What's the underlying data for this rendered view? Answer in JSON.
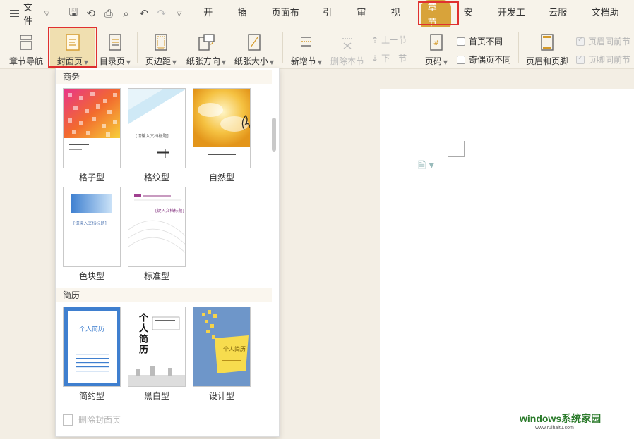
{
  "menubar": {
    "file_label": "文件",
    "tabs": [
      "开始",
      "插入",
      "页面布局",
      "引用",
      "审阅",
      "视图",
      "章节",
      "安全",
      "开发工具",
      "云服务",
      "文档助手"
    ],
    "active_tab": "章节"
  },
  "ribbon": {
    "nav": "章节导航",
    "cover": "封面页",
    "toc": "目录页",
    "margins": "页边距",
    "orientation": "纸张方向",
    "size": "纸张大小",
    "new_section": "新增节",
    "delete_section": "删除本节",
    "prev_section": "上一节",
    "next_section": "下一节",
    "page_number": "页码",
    "first_page_diff": "首页不同",
    "odd_even_diff": "奇偶页不同",
    "header_footer": "页眉和页脚",
    "header_same_prev": "页眉同前节",
    "footer_same_prev": "页脚同前节"
  },
  "panel": {
    "section_business": "商务",
    "section_resume": "简历",
    "business": [
      {
        "name": "格子型"
      },
      {
        "name": "格纹型",
        "title": "[请输入文档标题]"
      },
      {
        "name": "自然型"
      },
      {
        "name": "色块型",
        "title": "[请输入文档标题]"
      },
      {
        "name": "标准型",
        "title": "[键入文档标题]"
      }
    ],
    "resume": [
      {
        "name": "简约型",
        "title": "个人简历"
      },
      {
        "name": "黑白型",
        "title": "个人简历"
      },
      {
        "name": "设计型",
        "title": "个人简历"
      }
    ],
    "remove_cover": "删除封面页"
  },
  "colors": {
    "accent": "#d8a33a",
    "highlight": "#e03030",
    "page": "#ffffff",
    "background": "#f3eee4"
  },
  "watermark": {
    "brand": "windows系统家园",
    "url": "www.ruihaitu.com"
  }
}
